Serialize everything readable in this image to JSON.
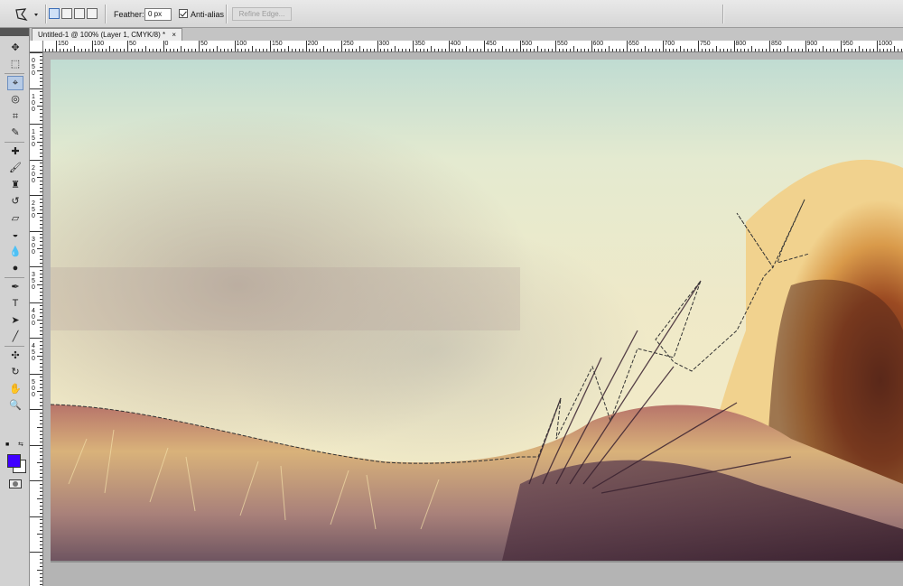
{
  "options_bar": {
    "feather_label": "Feather:",
    "feather_value": "0 px",
    "anti_alias_label": "Anti-alias",
    "anti_alias_checked": true,
    "refine_edge_label": "Refine Edge..."
  },
  "document_tab": {
    "title": "Untitled-1 @ 100% (Layer 1, CMYK/8) *",
    "close": "×"
  },
  "rulers": {
    "horizontal_labels": [
      "150",
      "100",
      "50",
      "0",
      "50",
      "100",
      "150",
      "200",
      "250",
      "300",
      "350",
      "400",
      "450",
      "500",
      "550",
      "600",
      "650",
      "700",
      "750",
      "800",
      "850",
      "900",
      "950",
      "1000"
    ],
    "vertical_labels": [
      "0",
      "5",
      "0",
      "1",
      "0",
      "0",
      "1",
      "5",
      "0",
      "2",
      "0",
      "0",
      "2",
      "5",
      "0",
      "3",
      "0",
      "0",
      "3",
      "5",
      "0",
      "4",
      "0",
      "0",
      "4",
      "5",
      "0",
      "5",
      "0",
      "0"
    ]
  },
  "toolbox": {
    "tools": [
      {
        "name": "move-tool-icon",
        "glyph": "✥"
      },
      {
        "name": "marquee-tool-icon",
        "glyph": "⬚"
      },
      {
        "name": "polygonal-lasso-tool-icon",
        "glyph": "⌖",
        "active": true
      },
      {
        "name": "quick-selection-tool-icon",
        "glyph": "◎"
      },
      {
        "name": "crop-tool-icon",
        "glyph": "⌗"
      },
      {
        "name": "eyedropper-tool-icon",
        "glyph": "✎"
      },
      {
        "name": "healing-brush-tool-icon",
        "glyph": "✚"
      },
      {
        "name": "brush-tool-icon",
        "glyph": "🖌"
      },
      {
        "name": "clone-stamp-tool-icon",
        "glyph": "♜"
      },
      {
        "name": "history-brush-tool-icon",
        "glyph": "↺"
      },
      {
        "name": "eraser-tool-icon",
        "glyph": "▱"
      },
      {
        "name": "paint-bucket-tool-icon",
        "glyph": "◒"
      },
      {
        "name": "blur-tool-icon",
        "glyph": "💧"
      },
      {
        "name": "dodge-tool-icon",
        "glyph": "●"
      },
      {
        "name": "pen-tool-icon",
        "glyph": "✒"
      },
      {
        "name": "type-tool-icon",
        "glyph": "T"
      },
      {
        "name": "path-selection-tool-icon",
        "glyph": "➤"
      },
      {
        "name": "line-tool-icon",
        "glyph": "╱"
      },
      {
        "name": "3d-rotate-tool-icon",
        "glyph": "✣"
      },
      {
        "name": "3d-orbit-tool-icon",
        "glyph": "↻"
      },
      {
        "name": "hand-tool-icon",
        "glyph": "✋"
      },
      {
        "name": "zoom-tool-icon",
        "glyph": "🔍"
      }
    ],
    "foreground_color": "#4000ff",
    "background_color": "#ffffff"
  }
}
